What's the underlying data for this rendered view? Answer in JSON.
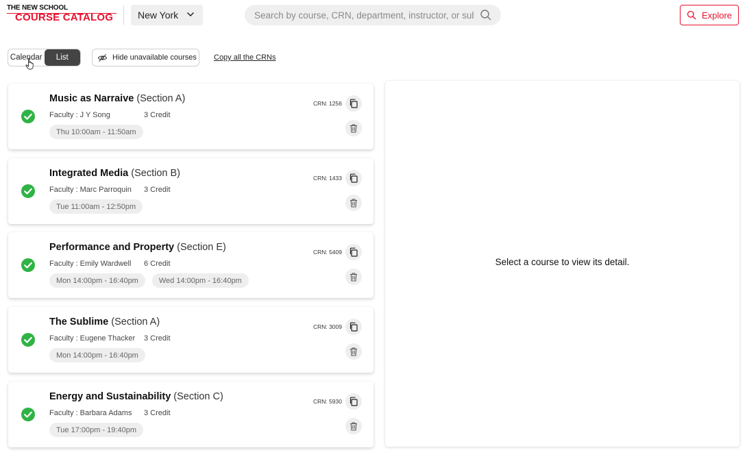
{
  "header": {
    "logo_top": "THE NEW SCHOOL",
    "logo_main": "COURSE CATALOG",
    "campus_selected": "New York",
    "search_placeholder": "Search by course, CRN, department, instructor, or subject",
    "search_value": "",
    "explore_label": "Explore",
    "accent_color": "#e8112d"
  },
  "toolbar": {
    "view_options": [
      "Calendar",
      "List"
    ],
    "active_view": "List",
    "hide_unavailable_label": "Hide unavailable courses",
    "copy_crns_label": "Copy all the CRNs"
  },
  "courses": [
    {
      "name": "Music as Narraive",
      "section": "(Section A)",
      "faculty": "Faculty : J Y Song",
      "credit": "3 Credit",
      "times": [
        "Thu 10:00am - 11:50am"
      ],
      "crn": "CRN: 1256",
      "status_icon": "check-circle-icon"
    },
    {
      "name": "Integrated Media",
      "section": "(Section B)",
      "faculty": "Faculty : Marc Parroquin",
      "credit": "3 Credit",
      "times": [
        "Tue 11:00am - 12:50pm"
      ],
      "crn": "CRN: 1433",
      "status_icon": "check-circle-icon"
    },
    {
      "name": "Performance and Property",
      "section": "(Section E)",
      "faculty": "Faculty : Emily Wardwell",
      "credit": "6 Credit",
      "times": [
        "Mon 14:00pm - 16:40pm",
        "Wed 14:00pm - 16:40pm"
      ],
      "crn": "CRN: 5409",
      "status_icon": "check-circle-icon"
    },
    {
      "name": "The Sublime",
      "section": "(Section A)",
      "faculty": "Faculty : Eugene Thacker",
      "credit": "3 Credit",
      "times": [
        "Mon 14:00pm - 16:40pm"
      ],
      "crn": "CRN: 3009",
      "status_icon": "check-circle-icon"
    },
    {
      "name": "Energy and Sustainability",
      "section": "(Section C)",
      "faculty": "Faculty : Barbara Adams",
      "credit": "3 Credit",
      "times": [
        "Tue 17:00pm - 19:40pm"
      ],
      "crn": "CRN: 5930",
      "status_icon": "check-circle-icon"
    }
  ],
  "detail": {
    "empty_message": "Select a course to view its detail."
  },
  "colors": {
    "check_green": "#2fb344",
    "toggle_active_bg": "#444444"
  }
}
